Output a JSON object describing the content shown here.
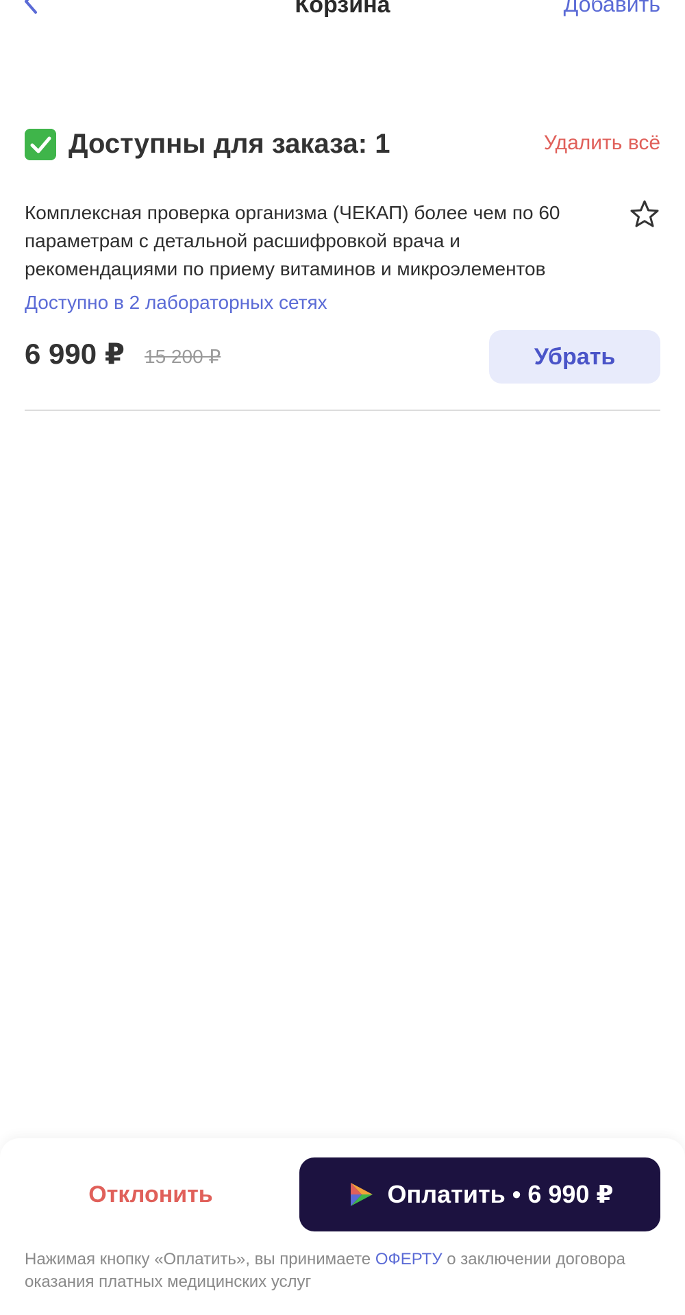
{
  "nav": {
    "title": "Корзина",
    "action_label": "Добавить"
  },
  "section": {
    "title": "Доступны для заказа: 1",
    "delete_all_label": "Удалить всё"
  },
  "item": {
    "title": "Комплексная проверка организма (ЧЕКАП) более чем по 60 параметрам с детальной расшифровкой врача и рекомендациями по приему витаминов и микроэлементов",
    "availability": "Доступно в 2 лабораторных сетях",
    "price": "6 990 ₽",
    "old_price": "15 200 ₽",
    "remove_label": "Убрать"
  },
  "bottom": {
    "decline_label": "Отклонить",
    "pay_label": "Оплатить • 6 990 ₽",
    "disclaimer_before": "Нажимая кнопку «Оплатить», вы принимаете ",
    "offer_link": "ОФЕРТУ",
    "disclaimer_after": " о заключении договора оказания платных медицинских услуг"
  },
  "colors": {
    "accent": "#5b6bd6",
    "danger": "#e0605a",
    "pay_button": "#1c1240",
    "remove_button_bg": "#e8ebfb",
    "check_green": "#3fb54a"
  },
  "icons": {
    "back": "chevron-left-icon",
    "check": "check-icon",
    "favorite": "star-icon",
    "pay_logo": "pay-logo-icon"
  }
}
